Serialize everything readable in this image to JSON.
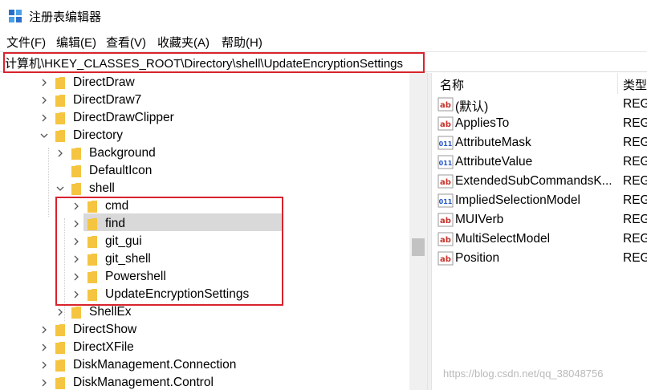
{
  "window": {
    "title": "注册表编辑器"
  },
  "menu": [
    "文件(F)",
    "编辑(E)",
    "查看(V)",
    "收藏夹(A)",
    "帮助(H)"
  ],
  "address": {
    "path": "计算机\\HKEY_CLASSES_ROOT\\Directory\\shell\\UpdateEncryptionSettings"
  },
  "tree": {
    "items": [
      {
        "label": "DirectDraw",
        "expanded": false
      },
      {
        "label": "DirectDraw7",
        "expanded": false
      },
      {
        "label": "DirectDrawClipper",
        "expanded": false
      },
      {
        "label": "Directory",
        "expanded": true
      },
      {
        "label": "Background",
        "expanded": false
      },
      {
        "label": "DefaultIcon",
        "expanded": null
      },
      {
        "label": "shell",
        "expanded": true
      },
      {
        "label": "cmd",
        "expanded": false
      },
      {
        "label": "find",
        "expanded": false
      },
      {
        "label": "git_gui",
        "expanded": false
      },
      {
        "label": "git_shell",
        "expanded": false
      },
      {
        "label": "Powershell",
        "expanded": false
      },
      {
        "label": "UpdateEncryptionSettings",
        "expanded": false,
        "selected": true
      },
      {
        "label": "ShellEx",
        "expanded": false
      },
      {
        "label": "DirectShow",
        "expanded": false
      },
      {
        "label": "DirectXFile",
        "expanded": false
      },
      {
        "label": "DiskManagement.Connection",
        "expanded": false
      },
      {
        "label": "DiskManagement.Control",
        "expanded": false
      }
    ]
  },
  "values": {
    "headers": {
      "name": "名称",
      "type": "类型"
    },
    "rows": [
      {
        "name": "(默认)",
        "type": "REG_",
        "icon": "string-value-icon"
      },
      {
        "name": "AppliesTo",
        "type": "REG_",
        "icon": "string-value-icon"
      },
      {
        "name": "AttributeMask",
        "type": "REG_",
        "icon": "binary-value-icon"
      },
      {
        "name": "AttributeValue",
        "type": "REG_",
        "icon": "binary-value-icon"
      },
      {
        "name": "ExtendedSubCommandsK...",
        "type": "REG_",
        "icon": "string-value-icon"
      },
      {
        "name": "ImpliedSelectionModel",
        "type": "REG_",
        "icon": "binary-value-icon"
      },
      {
        "name": "MUIVerb",
        "type": "REG_",
        "icon": "string-value-icon"
      },
      {
        "name": "MultiSelectModel",
        "type": "REG_",
        "icon": "string-value-icon"
      },
      {
        "name": "Position",
        "type": "REG_",
        "icon": "string-value-icon"
      }
    ]
  },
  "watermark": "https://blog.csdn.net/qq_38048756",
  "colors": {
    "highlight": "#d9232d",
    "folder": "#f5c441",
    "selection": "#d9d9d9"
  }
}
